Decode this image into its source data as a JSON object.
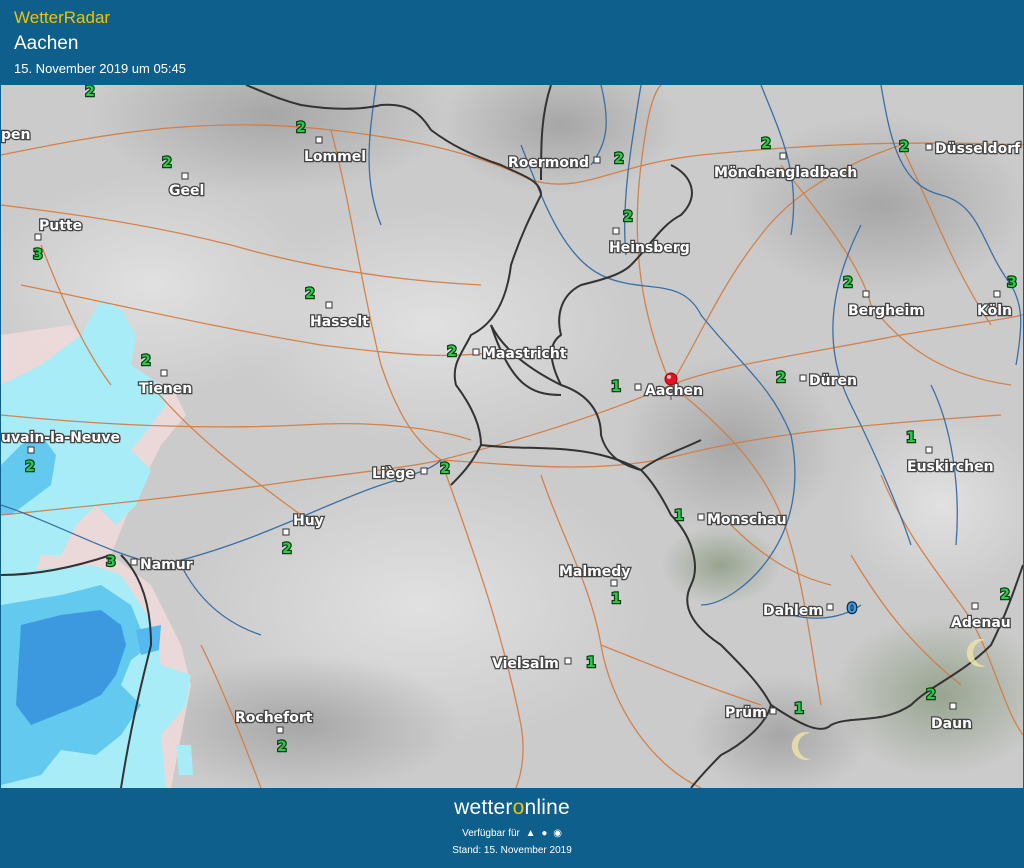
{
  "header": {
    "app_title": "WetterRadar",
    "location": "Aachen",
    "datetime": "15. November 2019 um 05:45"
  },
  "footer": {
    "brand_prefix": "wetter",
    "brand_o": "o",
    "brand_suffix": "nline",
    "available_label": "Verfügbar für",
    "platform_icons": [
      "android-icon",
      "apple-icon",
      "web-icon"
    ],
    "stand": "Stand: 15. November 2019"
  },
  "colors": {
    "header_bg": "#0f5f8c",
    "title_yellow": "#f2c200",
    "value_green": "#2fc84a",
    "marker_red": "#e3141b",
    "precip_light": "#a8ecf7",
    "precip_mid": "#63c9ef",
    "precip_dark": "#3c99e0"
  },
  "cities": [
    {
      "name": "Lommel"
    },
    {
      "name": "Roermond"
    },
    {
      "name": "Mönchengladbach"
    },
    {
      "name": "Düsseldorf"
    },
    {
      "name": "Geel"
    },
    {
      "name": "Putte"
    },
    {
      "name": "Heinsberg"
    },
    {
      "name": "Hasselt"
    },
    {
      "name": "Bergheim"
    },
    {
      "name": "Köln"
    },
    {
      "name": "Maastricht"
    },
    {
      "name": "Tienen"
    },
    {
      "name": "Aachen"
    },
    {
      "name": "Düren"
    },
    {
      "name": "uvain-la-Neuve"
    },
    {
      "name": "Euskirchen"
    },
    {
      "name": "Liège"
    },
    {
      "name": "Huy"
    },
    {
      "name": "Monschau"
    },
    {
      "name": "Namur"
    },
    {
      "name": "Malmedy"
    },
    {
      "name": "Dahlem"
    },
    {
      "name": "Adenau"
    },
    {
      "name": "Vielsalm"
    },
    {
      "name": "Prüm"
    },
    {
      "name": "Rochefort"
    },
    {
      "name": "Daun"
    },
    {
      "name": "pen"
    }
  ],
  "values": [
    {
      "v": "2"
    },
    {
      "v": "2"
    },
    {
      "v": "2"
    },
    {
      "v": "2"
    },
    {
      "v": "2"
    },
    {
      "v": "2"
    },
    {
      "v": "3"
    },
    {
      "v": "2"
    },
    {
      "v": "2"
    },
    {
      "v": "2"
    },
    {
      "v": "3"
    },
    {
      "v": "2"
    },
    {
      "v": "2"
    },
    {
      "v": "1"
    },
    {
      "v": "2"
    },
    {
      "v": "2"
    },
    {
      "v": "1"
    },
    {
      "v": "2"
    },
    {
      "v": "2"
    },
    {
      "v": "1"
    },
    {
      "v": "3"
    },
    {
      "v": "1"
    },
    {
      "v": "0"
    },
    {
      "v": "2"
    },
    {
      "v": "1"
    },
    {
      "v": "1"
    },
    {
      "v": "2"
    },
    {
      "v": "2"
    }
  ]
}
